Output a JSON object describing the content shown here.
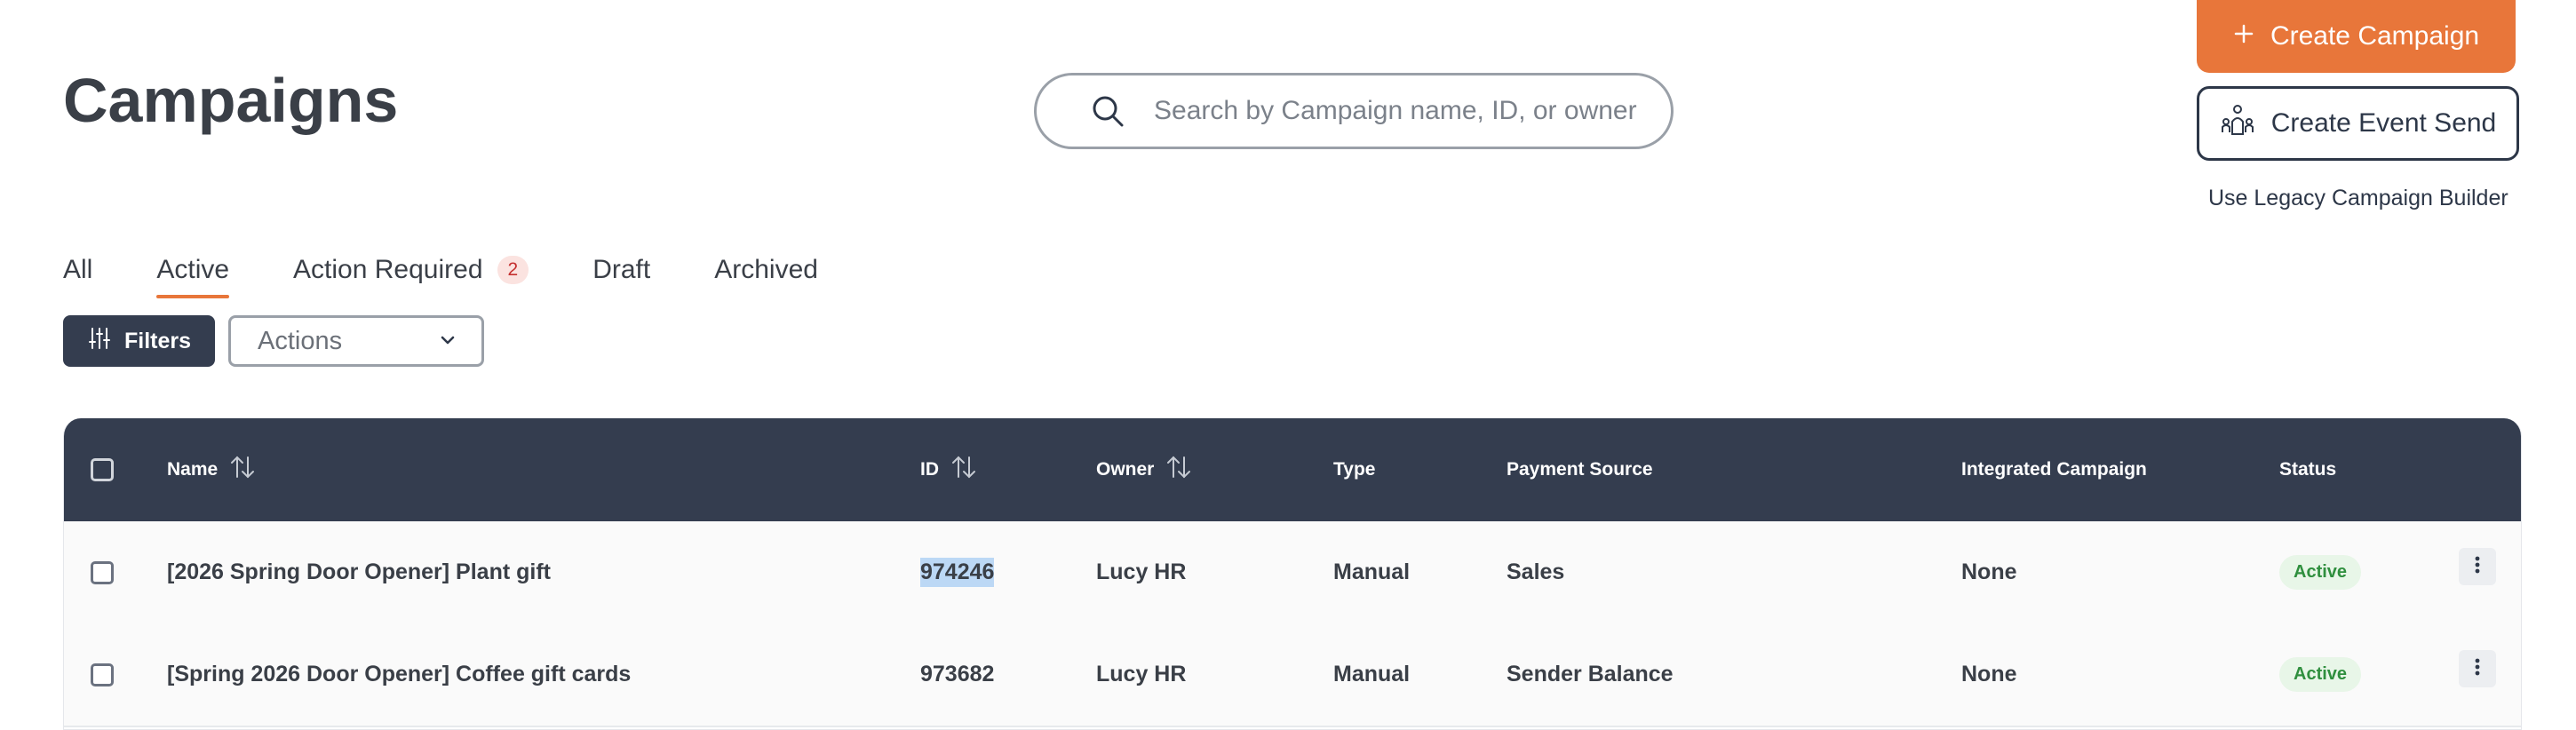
{
  "header": {
    "title": "Campaigns",
    "search_placeholder": "Search by Campaign name, ID, or owner",
    "create_campaign_label": "Create Campaign",
    "create_event_send_label": "Create Event Send",
    "legacy_link_label": "Use Legacy Campaign Builder"
  },
  "tabs": [
    {
      "label": "All"
    },
    {
      "label": "Active",
      "active": true
    },
    {
      "label": "Action Required",
      "badge": "2"
    },
    {
      "label": "Draft"
    },
    {
      "label": "Archived"
    }
  ],
  "toolbar": {
    "filters_label": "Filters",
    "actions_label": "Actions"
  },
  "table": {
    "columns": {
      "name": "Name",
      "id": "ID",
      "owner": "Owner",
      "type": "Type",
      "payment_source": "Payment Source",
      "integrated": "Integrated Campaign",
      "status": "Status"
    },
    "rows": [
      {
        "name": "[2026 Spring Door Opener] Plant gift",
        "id": "974246",
        "owner": "Lucy HR",
        "type": "Manual",
        "payment_source": "Sales",
        "integrated": "None",
        "status": "Active"
      },
      {
        "name": "[Spring 2026 Door Opener] Coffee gift cards",
        "id": "973682",
        "owner": "Lucy HR",
        "type": "Manual",
        "payment_source": "Sender Balance",
        "integrated": "None",
        "status": "Active"
      }
    ]
  },
  "colors": {
    "accent": "#e8763a",
    "header_dark": "#343d4f",
    "status_green": "#2f8f3e",
    "badge_red": "#c53030"
  },
  "icons": [
    "search-icon",
    "plus-icon",
    "event-send-icon",
    "filter-sliders-icon",
    "chevron-down-icon",
    "sort-icon",
    "kebab-menu-icon"
  ]
}
